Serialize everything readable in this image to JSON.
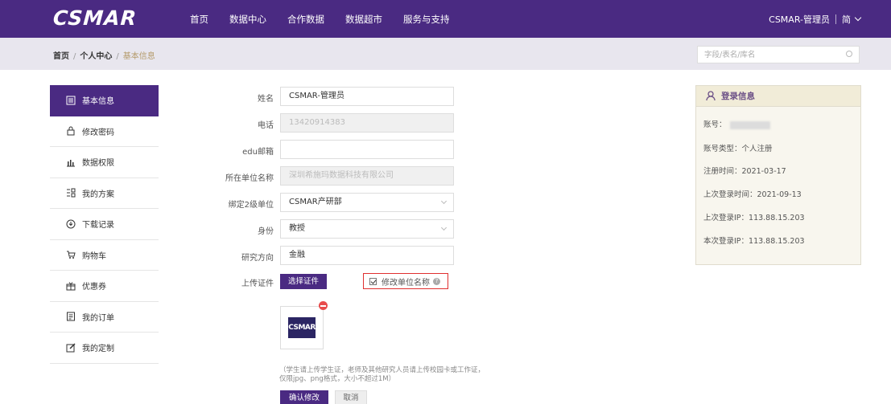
{
  "brand": {
    "logo_text": "CSMAR",
    "primary_color": "#4a2a82",
    "highlight_color": "#e03030"
  },
  "topnav": {
    "menu": [
      "首页",
      "数据中心",
      "合作数据",
      "数据超市",
      "服务与支持"
    ],
    "user_name": "CSMAR-管理员",
    "lang": "简"
  },
  "breadcrumb": {
    "items": [
      "首页",
      "个人中心",
      "基本信息"
    ]
  },
  "search": {
    "placeholder": "字段/表名/库名"
  },
  "sidebar": {
    "items": [
      {
        "label": "基本信息",
        "icon": "list-icon",
        "active": true
      },
      {
        "label": "修改密码",
        "icon": "lock-icon"
      },
      {
        "label": "数据权限",
        "icon": "bar-chart-icon"
      },
      {
        "label": "我的方案",
        "icon": "plan-icon"
      },
      {
        "label": "下载记录",
        "icon": "download-icon"
      },
      {
        "label": "购物车",
        "icon": "cart-icon"
      },
      {
        "label": "优惠券",
        "icon": "coupon-icon"
      },
      {
        "label": "我的订单",
        "icon": "order-icon"
      },
      {
        "label": "我的定制",
        "icon": "edit-icon"
      }
    ]
  },
  "form": {
    "name": {
      "label": "姓名",
      "value": "CSMAR-管理员"
    },
    "phone": {
      "label": "电话",
      "value": "13420914383"
    },
    "edu_email": {
      "label": "edu邮箱",
      "value": ""
    },
    "org_name": {
      "label": "所在单位名称",
      "value": "深圳希施玛数据科技有限公司"
    },
    "sub_org": {
      "label": "绑定2级单位",
      "value": "CSMAR产研部"
    },
    "identity": {
      "label": "身份",
      "value": "教授"
    },
    "research": {
      "label": "研究方向",
      "value": "金融"
    },
    "upload": {
      "label": "上传证件",
      "button": "选择证件",
      "thumb_text": "CSMAR"
    },
    "modify_org": {
      "label": "修改单位名称",
      "checked": true
    },
    "hint_line1": "（学生请上传学生证，老师及其他研究人员请上传校园卡或工作证，",
    "hint_line2": "仅限jpg、png格式，大小不超过1M）",
    "confirm": "确认修改",
    "cancel": "取消"
  },
  "login_info": {
    "title": "登录信息",
    "account_label": "账号：",
    "account_type": "账号类型：个人注册",
    "register_time": "注册时间：2021-03-17",
    "last_login_time": "上次登录时间：2021-09-13",
    "last_login_ip": "上次登录IP：113.88.15.203",
    "current_ip": "本次登录IP：113.88.15.203"
  }
}
